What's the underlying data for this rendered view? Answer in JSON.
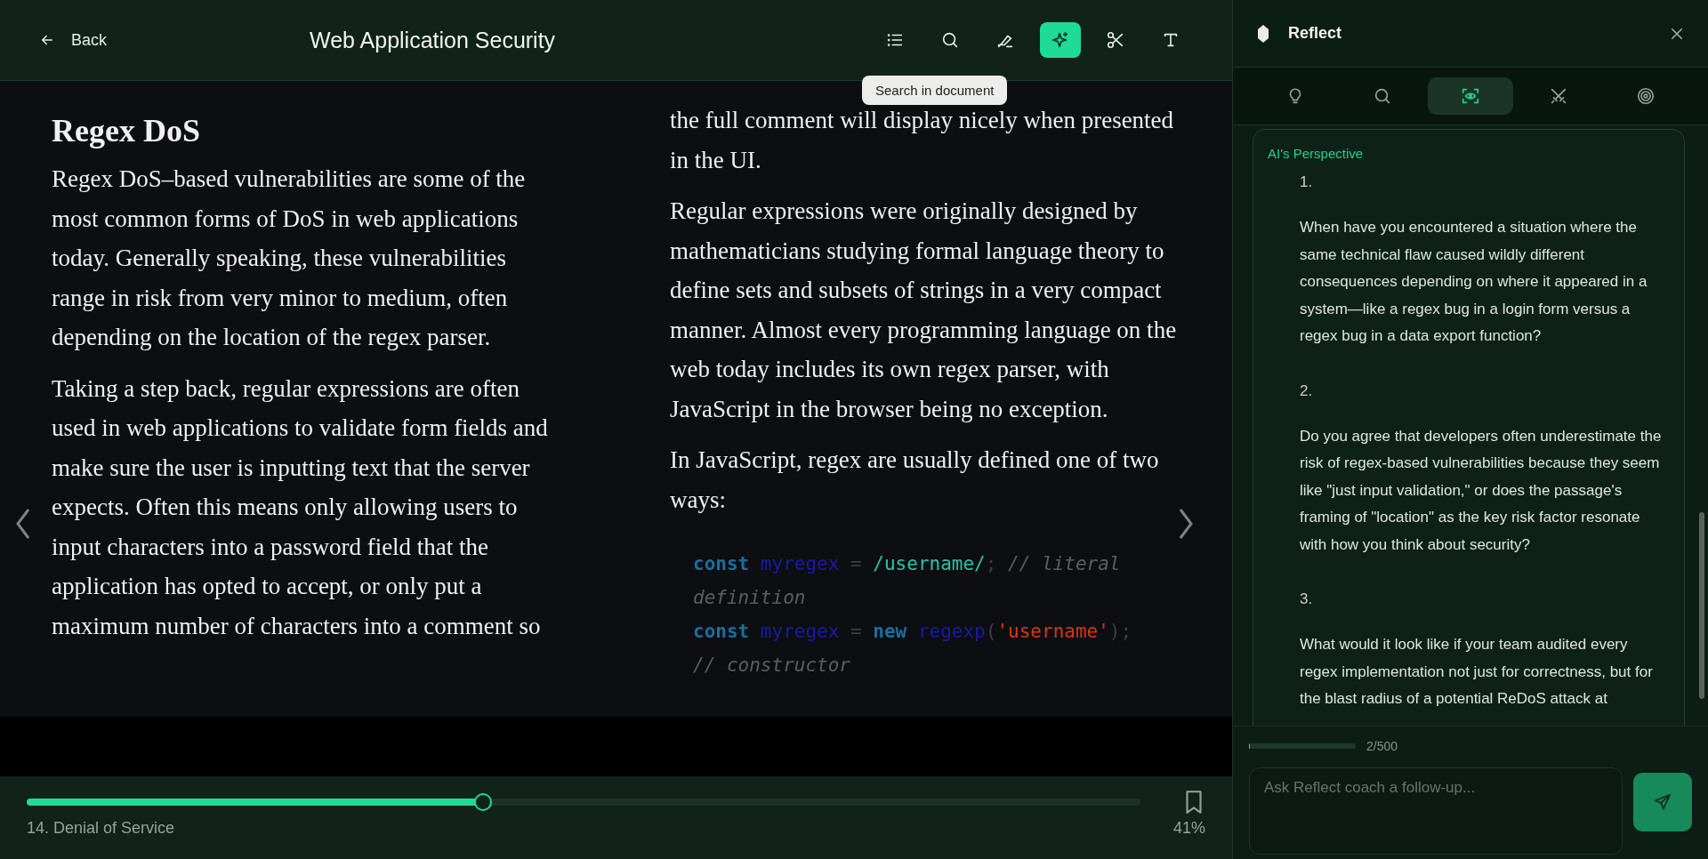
{
  "header": {
    "back": "Back",
    "title": "Web Application Security",
    "tools": [
      {
        "selected": false
      },
      {
        "selected": false
      },
      {
        "selected": false
      },
      {
        "selected": true
      },
      {
        "selected": false
      },
      {
        "selected": false
      }
    ],
    "tooltip": "Search in document"
  },
  "page_left": {
    "heading": "Regex DoS",
    "paragraphs": [
      "Regex DoS–based vulnerabilities are some of the most common forms of DoS in web applications today. Generally speaking, these vulnerabilities range in risk from very minor to medium, often depending on the location of the regex parser.",
      "Taking a step back, regular expressions are often used in web applications to validate form fields and make sure the user is inputting text that the server expects. Often this means only allowing users to input characters into a password field that the application has opted to accept, or only put a maximum number of characters into a comment so"
    ]
  },
  "page_right": {
    "paragraphs": [
      "the full comment will display nicely when presented in the UI.",
      "Regular expressions were originally designed by mathematicians studying formal language theory to define sets and subsets of strings in a very compact manner. Almost every programming language on the web today includes its own regex parser, with JavaScript in the browser being no exception.",
      "In JavaScript, regex are usually defined one of two ways:"
    ],
    "code": [
      [
        {
          "kind": "keyword",
          "text": "const"
        },
        {
          "kind": "name",
          "text": " myregex"
        },
        {
          "kind": "punct",
          "text": " = "
        },
        {
          "kind": "regex",
          "text": "/username/"
        },
        {
          "kind": "punct",
          "text": "; "
        },
        {
          "kind": "comment",
          "text": "// literal definition"
        }
      ],
      [
        {
          "kind": "keyword",
          "text": "const"
        },
        {
          "kind": "name",
          "text": " myregex"
        },
        {
          "kind": "punct",
          "text": " = "
        },
        {
          "kind": "keyword",
          "text": "new"
        },
        {
          "kind": "name",
          "text": " regexp"
        },
        {
          "kind": "punct",
          "text": "("
        },
        {
          "kind": "string",
          "text": "'username'"
        },
        {
          "kind": "punct",
          "text": "); "
        },
        {
          "kind": "comment",
          "text": "// constructor"
        }
      ]
    ]
  },
  "footer": {
    "chapter": "14. Denial of Service",
    "level": 0.41,
    "percent": "41%"
  },
  "panel": {
    "title": "Reflect",
    "tabs": [
      {
        "selected": false
      },
      {
        "selected": false
      },
      {
        "selected": true
      },
      {
        "selected": false
      },
      {
        "selected": false
      }
    ],
    "card_title": "AI's Perspective",
    "questions": [
      {
        "number": "1.",
        "text": "When have you encountered a situation where the same technical flaw caused wildly different consequences depending on where it appeared in a system—like a regex bug in a login form versus a regex bug in a data export function?"
      },
      {
        "number": "2.",
        "text": "Do you agree that developers often underestimate the risk of regex-based vulnerabilities because they seem like \"just input validation,\" or does the passage's framing of \"location\" as the key risk factor resonate with how you think about security?"
      },
      {
        "number": "3.",
        "text": "What would it look like if your team audited every regex implementation not just for correctness, but for the blast radius of a potential ReDoS attack at"
      }
    ],
    "counter": {
      "level": 0.004,
      "text": "2/500"
    },
    "input": {
      "placeholder": "Ask Reflect coach a follow-up..."
    }
  }
}
